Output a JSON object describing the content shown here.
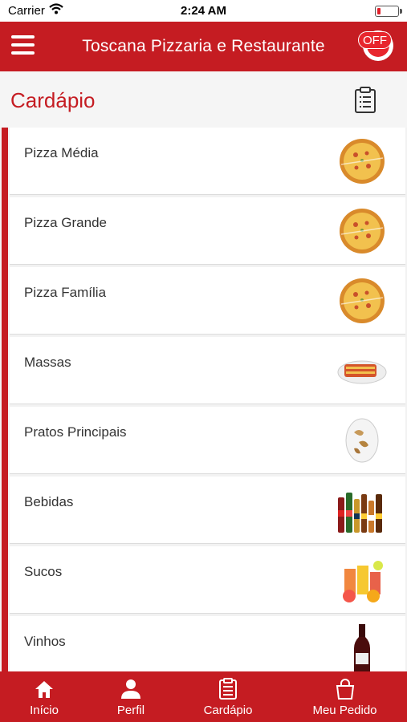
{
  "status_bar": {
    "carrier": "Carrier",
    "time": "2:24 AM"
  },
  "header": {
    "title": "Toscana Pizzaria e Restaurante",
    "status_toggle": "OFF"
  },
  "section": {
    "title": "Cardápio"
  },
  "categories": [
    {
      "label": "Pizza Média",
      "icon": "pizza-image"
    },
    {
      "label": "Pizza Grande",
      "icon": "pizza-image"
    },
    {
      "label": "Pizza Família",
      "icon": "pizza-image"
    },
    {
      "label": "Massas",
      "icon": "lasagna-image"
    },
    {
      "label": "Pratos Principais",
      "icon": "main-dish-image"
    },
    {
      "label": "Bebidas",
      "icon": "drinks-image"
    },
    {
      "label": "Sucos",
      "icon": "juices-image"
    },
    {
      "label": "Vinhos",
      "icon": "wine-image"
    }
  ],
  "tabs": [
    {
      "label": "Início",
      "icon": "home-icon"
    },
    {
      "label": "Perfil",
      "icon": "person-icon"
    },
    {
      "label": "Cardápio",
      "icon": "clipboard-icon"
    },
    {
      "label": "Meu Pedido",
      "icon": "bag-icon"
    }
  ],
  "colors": {
    "brand": "#c51c22",
    "background": "#f2f2f2"
  }
}
